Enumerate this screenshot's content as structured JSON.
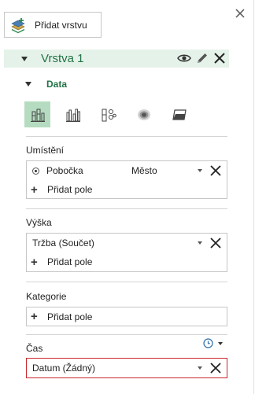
{
  "pane": {
    "add_layer_label": "Přidat vrstvu"
  },
  "layer": {
    "title": "Vrstva 1"
  },
  "data_section": {
    "title": "Data",
    "vis_types": [
      "stacked-column-icon",
      "clustered-column-icon",
      "bubble-icon",
      "heat-map-icon",
      "region-icon"
    ],
    "active_index": 0
  },
  "location": {
    "label": "Umístění",
    "field": "Pobočka",
    "type": "Město",
    "add_label": "Přidat pole"
  },
  "height": {
    "label": "Výška",
    "field": "Tržba (Součet)",
    "add_label": "Přidat pole"
  },
  "category": {
    "label": "Kategorie",
    "add_label": "Přidat pole"
  },
  "time": {
    "label": "Čas",
    "field": "Datum (Žádný)"
  },
  "colors": {
    "accent_green": "#217346",
    "layer_bar_bg": "#e5f2e9",
    "active_vis_bg": "#b5dcc0",
    "error_border": "#c8262a"
  }
}
